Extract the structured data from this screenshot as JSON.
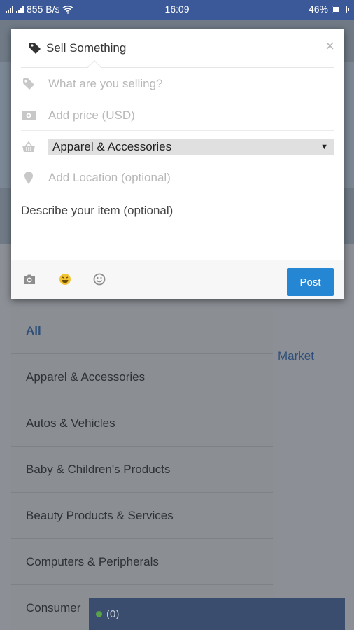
{
  "status_bar": {
    "network_speed": "855 B/s",
    "time": "16:09",
    "battery": "46%",
    "battery_level": 0.46
  },
  "dialog": {
    "title": "Sell Something",
    "title_icon": "tag-icon",
    "close_icon": "close-icon",
    "item_field": {
      "placeholder": "What are you selling?",
      "icon": "tag-icon"
    },
    "price_field": {
      "placeholder": "Add price (USD)",
      "icon": "money-icon"
    },
    "category_field": {
      "selected": "Apparel & Accessories",
      "icon": "basket-icon"
    },
    "location_field": {
      "placeholder": "Add Location (optional)",
      "icon": "location-pin-icon"
    },
    "description": {
      "placeholder": "Describe your item (optional)"
    },
    "footer": {
      "icons": [
        "camera-icon",
        "emoji-icon",
        "smiley-icon"
      ],
      "post_label": "Post"
    },
    "accent_color": "#2586d3"
  },
  "background": {
    "categories": [
      "All",
      "Apparel & Accessories",
      "Autos & Vehicles",
      "Baby & Children's Products",
      "Beauty Products & Services",
      "Computers & Peripherals",
      "Consumer"
    ],
    "active_category": "All",
    "side_text": "Market",
    "chat_count": "(0)"
  }
}
